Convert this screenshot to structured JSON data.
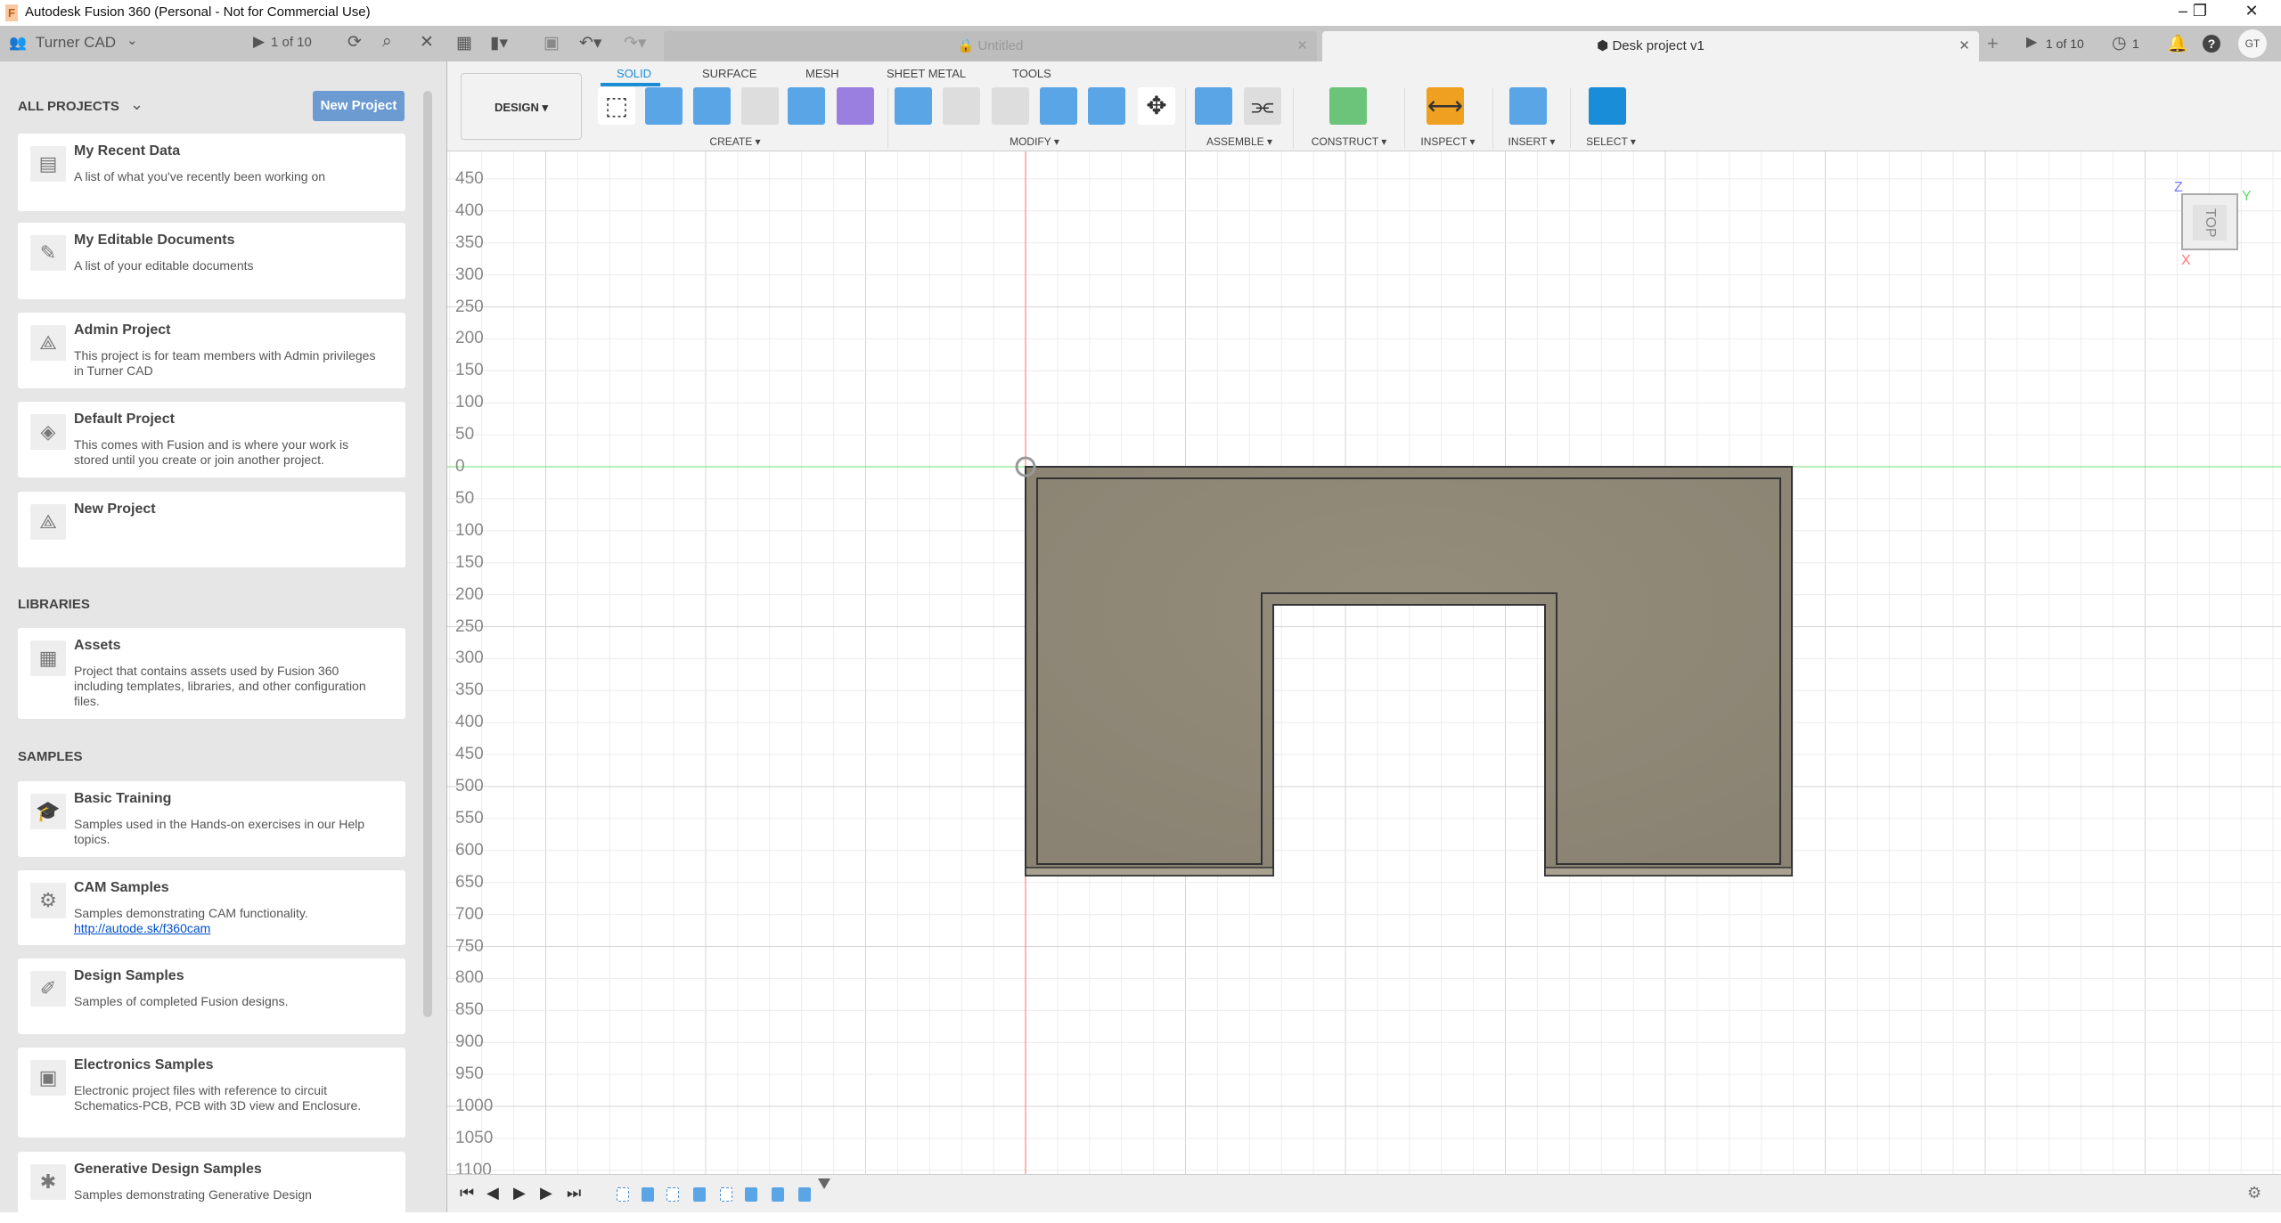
{
  "window": {
    "title": "Autodesk Fusion 360 (Personal - Not for Commercial Use)",
    "logo": "F",
    "controls": [
      "–",
      "❐",
      "✕"
    ]
  },
  "panel": {
    "team": "Turner CAD",
    "jobs": "1 of 10",
    "all_projects": "ALL PROJECTS",
    "new_project": "New Project",
    "projects": [
      {
        "title": "My Recent Data",
        "desc": "A list of what you've recently been working on",
        "icon": "documents-icon"
      },
      {
        "title": "My Editable Documents",
        "desc": "A list of your editable documents",
        "icon": "edit-document-icon"
      },
      {
        "title": "Admin Project",
        "desc": "This project is for team members with Admin privileges in Turner CAD",
        "icon": "project-icon"
      },
      {
        "title": "Default Project",
        "desc": "This comes with Fusion and is where your work is stored until you create or join another project.",
        "icon": "default-project-icon"
      },
      {
        "title": "New Project",
        "desc": "",
        "icon": "project-icon"
      }
    ],
    "libraries_label": "LIBRARIES",
    "libraries": [
      {
        "title": "Assets",
        "desc": "Project that contains assets used by Fusion 360 including templates, libraries, and other configuration files.",
        "icon": "assets-icon"
      }
    ],
    "samples_label": "SAMPLES",
    "samples": [
      {
        "title": "Basic Training",
        "desc": "Samples used in the Hands-on exercises in our Help topics.",
        "icon": "graduation-cap-icon"
      },
      {
        "title": "CAM Samples",
        "desc": "Samples demonstrating CAM functionality.",
        "link": "http://autode.sk/f360cam",
        "icon": "cam-icon"
      },
      {
        "title": "Design Samples",
        "desc": "Samples of completed Fusion designs.",
        "icon": "design-icon"
      },
      {
        "title": "Electronics Samples",
        "desc": "Electronic project files with reference to circuit Schematics-PCB, PCB with 3D view and Enclosure.",
        "icon": "electronics-icon"
      },
      {
        "title": "Generative Design Samples",
        "desc": "Samples demonstrating Generative Design",
        "icon": "generative-icon"
      }
    ]
  },
  "tabs": [
    {
      "label": "Untitled",
      "active": false
    },
    {
      "label": "Desk project v1",
      "active": true
    }
  ],
  "topright": {
    "jobs": "1 of 10",
    "clock_count": "1",
    "avatar": "GT"
  },
  "toolbar": {
    "workspace": "DESIGN ▾",
    "tabs": [
      "SOLID",
      "SURFACE",
      "MESH",
      "SHEET METAL",
      "TOOLS"
    ],
    "groups": [
      "CREATE ▾",
      "MODIFY ▾",
      "ASSEMBLE ▾",
      "CONSTRUCT ▾",
      "INSPECT ▾",
      "INSERT ▾",
      "SELECT ▾"
    ]
  },
  "viewcube": {
    "face": "TOP",
    "x": "X",
    "y": "Y",
    "z": "Z"
  },
  "ruler": [
    "450",
    "400",
    "350",
    "300",
    "250",
    "200",
    "150",
    "100",
    "50",
    "0",
    "50",
    "100",
    "150",
    "200",
    "250",
    "300",
    "350",
    "400",
    "450",
    "500",
    "550",
    "600",
    "650",
    "700",
    "750",
    "800",
    "850",
    "900",
    "950",
    "1000",
    "1050",
    "1100"
  ],
  "colors": {
    "accent": "#1a8dd8",
    "body": "#8e8777",
    "x_axis": "#ff6b6b",
    "y_axis": "#6ee06e"
  }
}
